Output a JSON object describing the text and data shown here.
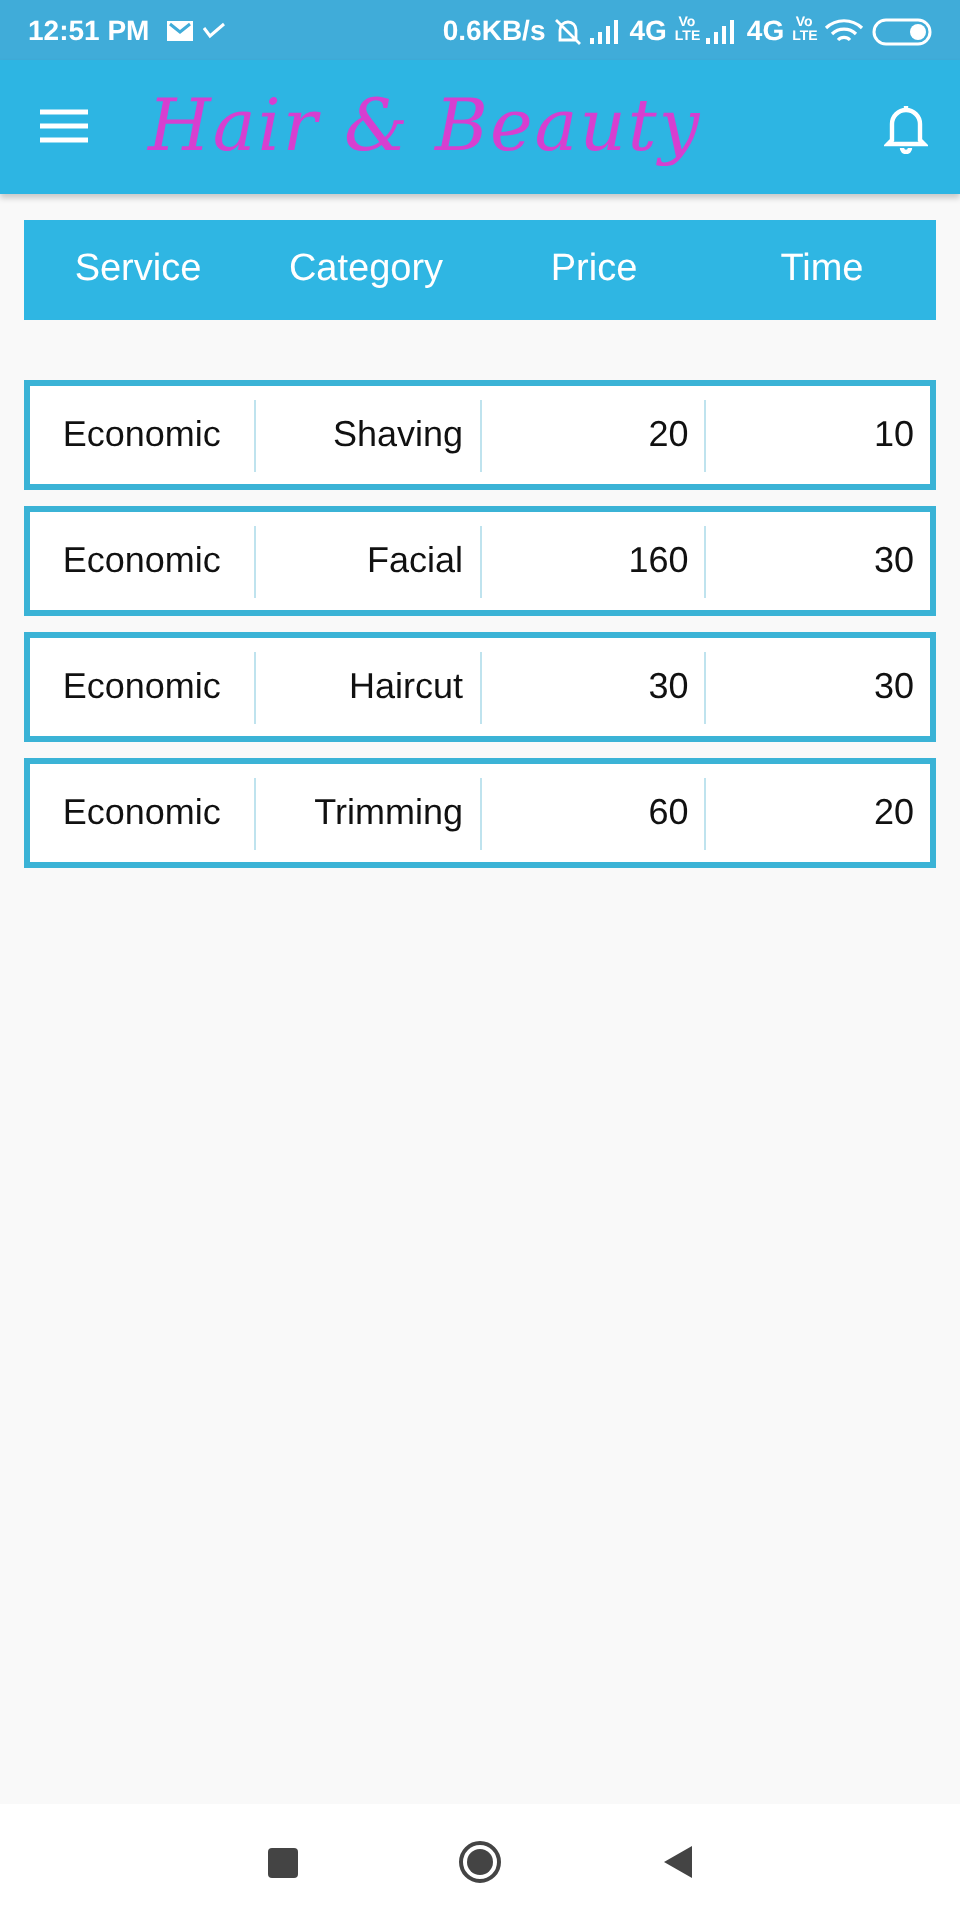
{
  "status_bar": {
    "time": "12:51 PM",
    "speed": "0.6KB/s",
    "networks": [
      {
        "type": "4G",
        "volte": "Vo LTE"
      },
      {
        "type": "4G",
        "volte": "Vo LTE"
      }
    ]
  },
  "app_bar": {
    "title": "Hair & Beauty"
  },
  "table": {
    "columns": [
      "Service",
      "Category",
      "Price",
      "Time"
    ],
    "rows": [
      {
        "cells": [
          "Economic",
          "Shaving",
          "20",
          "10"
        ]
      },
      {
        "cells": [
          "Economic",
          "Facial",
          "160",
          "30"
        ]
      },
      {
        "cells": [
          "Economic",
          "Haircut",
          "30",
          "30"
        ]
      },
      {
        "cells": [
          "Economic",
          "Trimming",
          "60",
          "20"
        ]
      }
    ]
  }
}
